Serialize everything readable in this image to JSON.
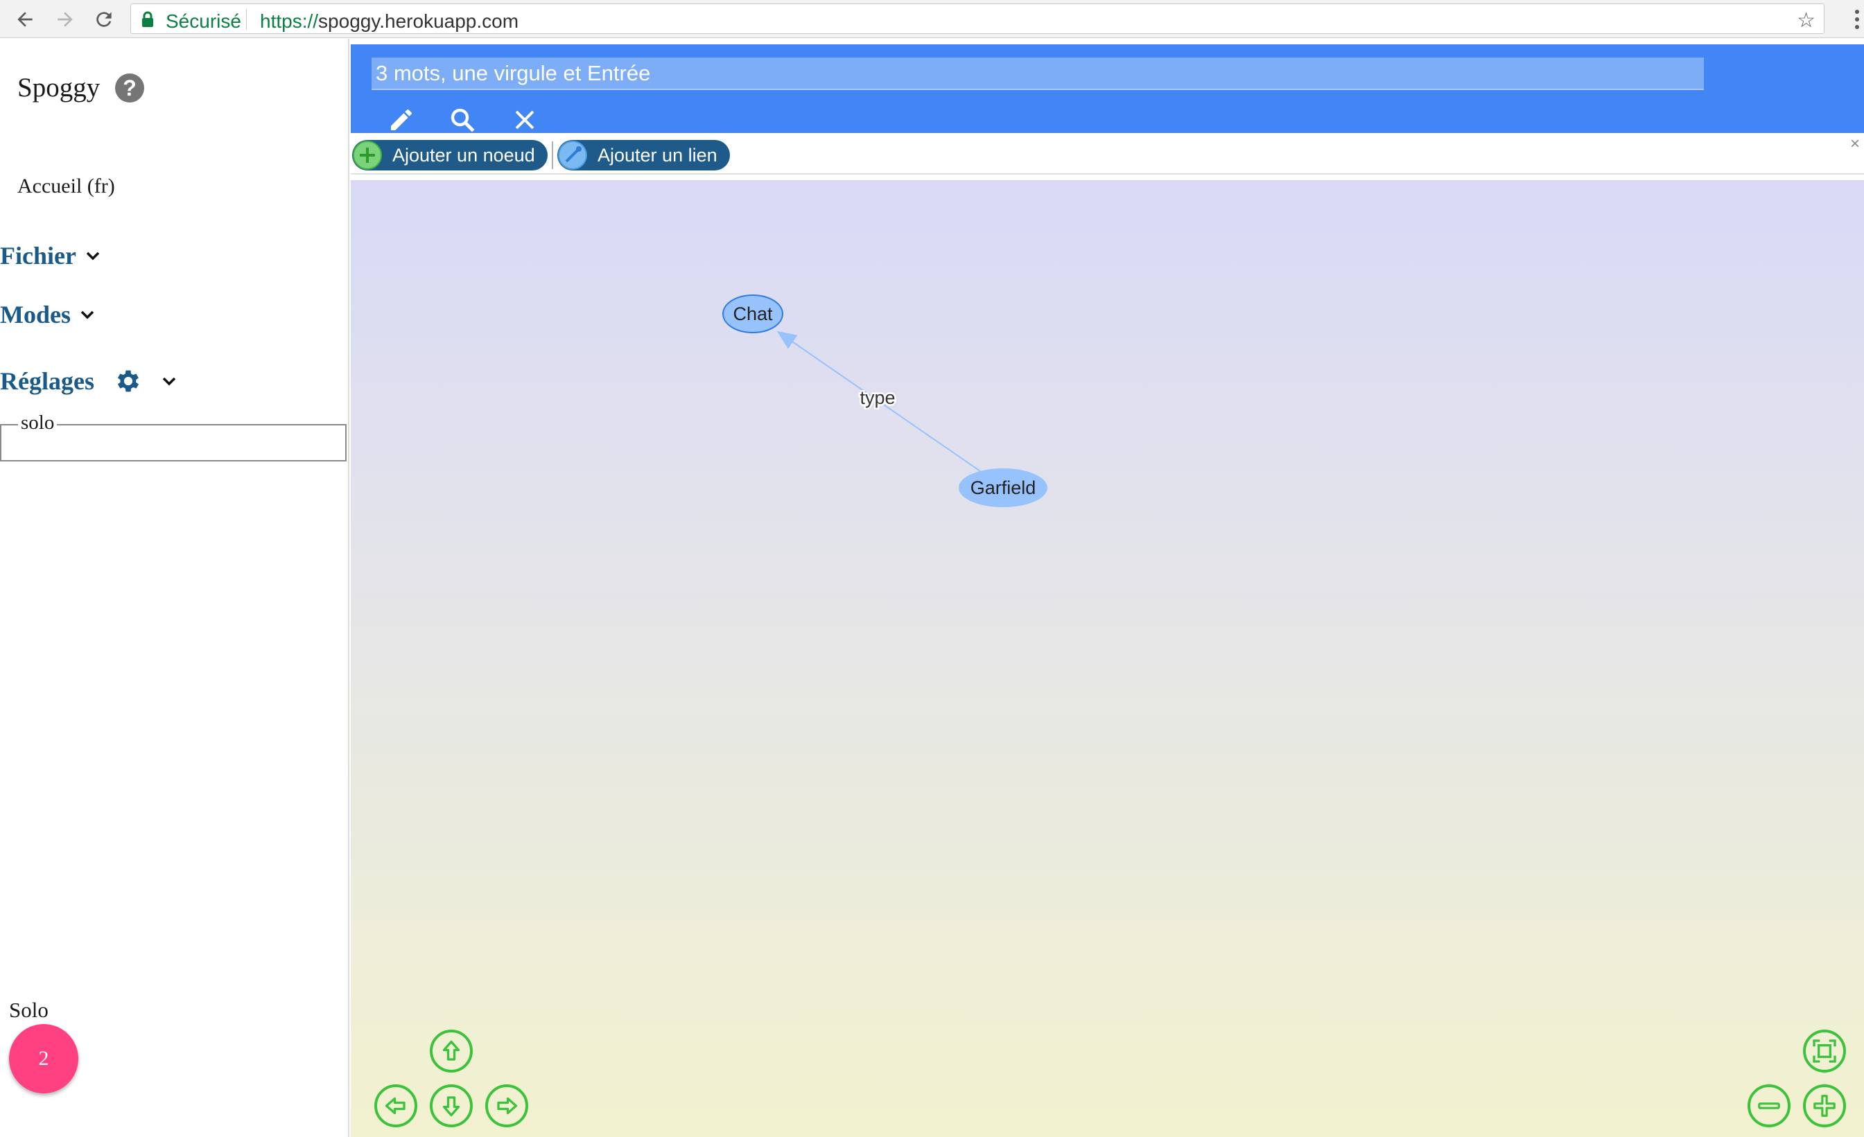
{
  "browser": {
    "secure_label": "Sécurisé",
    "url_prefix": "https://",
    "url_host": "spoggy.herokuapp.com",
    "icons": [
      "back-arrow-icon",
      "forward-arrow-icon",
      "reload-icon",
      "lock-icon",
      "bookmark-star-icon",
      "browser-menu-icon"
    ]
  },
  "sidebar": {
    "title": "Spoggy",
    "home_link": "Accueil (fr)",
    "menus": {
      "file": "Fichier",
      "modes": "Modes",
      "settings": "Réglages"
    },
    "mode_legend": "solo",
    "footer_label": "Solo",
    "badge_count": "2",
    "badge_color": "#ff4081"
  },
  "topbar": {
    "input_placeholder": "3 mots, une virgule et Entrée",
    "color": "#4285f4",
    "icons": [
      "pencil-icon",
      "search-icon",
      "close-icon"
    ]
  },
  "toolbar": {
    "add_node": "Ajouter un noeud",
    "add_edge": "Ajouter un lien",
    "close": "×"
  },
  "graph": {
    "nodes": [
      {
        "id": "chat",
        "label": "Chat"
      },
      {
        "id": "garfield",
        "label": "Garfield"
      }
    ],
    "edges": [
      {
        "from": "garfield",
        "to": "chat",
        "label": "type"
      }
    ],
    "node_color": "#97c2fc"
  },
  "controls": {
    "color": "#3cc23c",
    "icons": [
      "arrow-up-icon",
      "arrow-left-icon",
      "arrow-down-icon",
      "arrow-right-icon",
      "fit-view-icon",
      "zoom-out-icon",
      "zoom-in-icon"
    ]
  }
}
